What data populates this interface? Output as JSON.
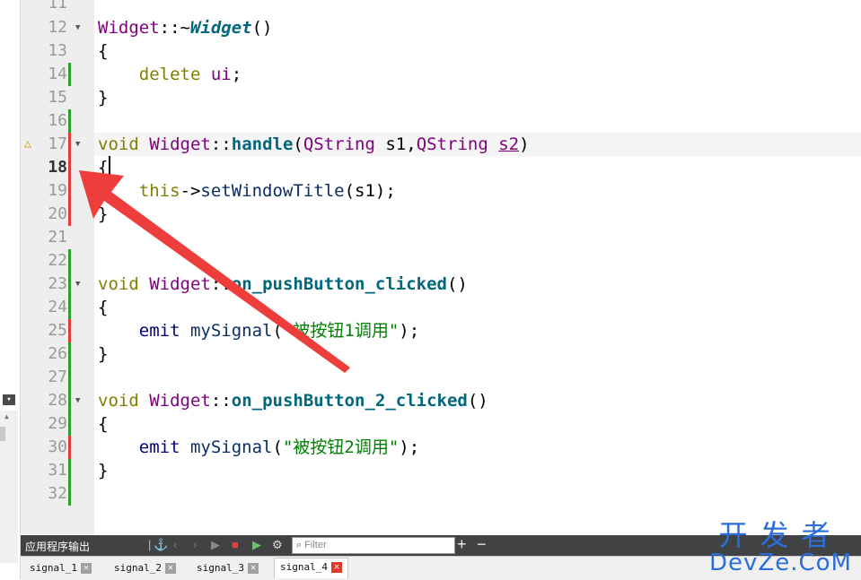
{
  "editor": {
    "first_line_partial": "11",
    "lines": [
      {
        "n": "12",
        "code": [
          {
            "t": "typ",
            "s": "Widget"
          },
          {
            "t": "",
            "s": "::~"
          },
          {
            "t": "fni",
            "s": "Widget"
          },
          {
            "t": "",
            "s": "()"
          }
        ],
        "fold": true
      },
      {
        "n": "13",
        "code": [
          {
            "t": "",
            "s": "{"
          }
        ]
      },
      {
        "n": "14",
        "code": [
          {
            "t": "",
            "s": "    "
          },
          {
            "t": "kw",
            "s": "delete"
          },
          {
            "t": "",
            "s": " "
          },
          {
            "t": "typ",
            "s": "ui"
          },
          {
            "t": "",
            "s": ";"
          }
        ]
      },
      {
        "n": "15",
        "code": [
          {
            "t": "",
            "s": "}"
          }
        ]
      },
      {
        "n": "16",
        "code": []
      },
      {
        "n": "17",
        "code": [
          {
            "t": "kw",
            "s": "void"
          },
          {
            "t": "",
            "s": " "
          },
          {
            "t": "typ",
            "s": "Widget"
          },
          {
            "t": "",
            "s": "::"
          },
          {
            "t": "fn",
            "s": "handle"
          },
          {
            "t": "",
            "s": "("
          },
          {
            "t": "typ",
            "s": "QString"
          },
          {
            "t": "",
            "s": " s1,"
          },
          {
            "t": "typ",
            "s": "QString"
          },
          {
            "t": "",
            "s": " "
          },
          {
            "t": "u",
            "s": "s2"
          },
          {
            "t": "",
            "s": ")"
          }
        ],
        "fold": true,
        "warn": true,
        "highlight": true
      },
      {
        "n": "18",
        "code": [
          {
            "t": "",
            "s": "{"
          }
        ],
        "current": true
      },
      {
        "n": "19",
        "code": [
          {
            "t": "",
            "s": "    "
          },
          {
            "t": "kw",
            "s": "this"
          },
          {
            "t": "",
            "s": "->"
          },
          {
            "t": "str2",
            "s": "setWindowTitle"
          },
          {
            "t": "",
            "s": "(s1);"
          }
        ]
      },
      {
        "n": "20",
        "code": [
          {
            "t": "",
            "s": "}"
          }
        ]
      },
      {
        "n": "21",
        "code": []
      },
      {
        "n": "22",
        "code": []
      },
      {
        "n": "23",
        "code": [
          {
            "t": "kw",
            "s": "void"
          },
          {
            "t": "",
            "s": " "
          },
          {
            "t": "typ",
            "s": "Widget"
          },
          {
            "t": "",
            "s": "::"
          },
          {
            "t": "fn",
            "s": "on_pushButton_clicked"
          },
          {
            "t": "",
            "s": "()"
          }
        ],
        "fold": true
      },
      {
        "n": "24",
        "code": [
          {
            "t": "",
            "s": "{"
          }
        ]
      },
      {
        "n": "25",
        "code": [
          {
            "t": "",
            "s": "    "
          },
          {
            "t": "mac",
            "s": "emit"
          },
          {
            "t": "",
            "s": " "
          },
          {
            "t": "str2",
            "s": "mySignal"
          },
          {
            "t": "",
            "s": "("
          },
          {
            "t": "str",
            "s": "\"被按钮1调用\""
          },
          {
            "t": "",
            "s": ");"
          }
        ]
      },
      {
        "n": "26",
        "code": [
          {
            "t": "",
            "s": "}"
          }
        ]
      },
      {
        "n": "27",
        "code": []
      },
      {
        "n": "28",
        "code": [
          {
            "t": "kw",
            "s": "void"
          },
          {
            "t": "",
            "s": " "
          },
          {
            "t": "typ",
            "s": "Widget"
          },
          {
            "t": "",
            "s": "::"
          },
          {
            "t": "fn",
            "s": "on_pushButton_2_clicked"
          },
          {
            "t": "",
            "s": "()"
          }
        ],
        "fold": true
      },
      {
        "n": "29",
        "code": [
          {
            "t": "",
            "s": "{"
          }
        ]
      },
      {
        "n": "30",
        "code": [
          {
            "t": "",
            "s": "    "
          },
          {
            "t": "mac",
            "s": "emit"
          },
          {
            "t": "",
            "s": " "
          },
          {
            "t": "str2",
            "s": "mySignal"
          },
          {
            "t": "",
            "s": "("
          },
          {
            "t": "str",
            "s": "\"被按钮2调用\""
          },
          {
            "t": "",
            "s": ");"
          }
        ]
      },
      {
        "n": "31",
        "code": [
          {
            "t": "",
            "s": "}"
          }
        ]
      },
      {
        "n": "32",
        "code": []
      }
    ],
    "change_marks": {
      "14": "#2e9e2e",
      "16": "#2e9e2e",
      "17": "#e33b3b",
      "18": "#e33b3b",
      "19": "#e33b3b",
      "20": "#e33b3b",
      "22": "#2e9e2e",
      "23": "#2e9e2e",
      "24": "#2e9e2e",
      "25": "#e33b3b",
      "26": "#2e9e2e",
      "27": "#2e9e2e",
      "28": "#2e9e2e",
      "29": "#2e9e2e",
      "30": "#e33b3b",
      "31": "#2e9e2e",
      "32": "#2e9e2e"
    }
  },
  "output_pane": {
    "title": "应用程序输出",
    "filter_placeholder": "Filter",
    "add_label": "+",
    "remove_label": "−"
  },
  "tabs": [
    {
      "label": "signal_1",
      "active": false
    },
    {
      "label": "signal_2",
      "active": false
    },
    {
      "label": "signal_3",
      "active": false
    },
    {
      "label": "signal_4",
      "active": true
    }
  ],
  "tab_close_glyph": "✕",
  "watermark": {
    "cn": "开发者",
    "en": "DevZe.CoM"
  },
  "colors": {
    "arrow": "#ee3e3b",
    "watermark": "#2a6fd8",
    "keyword": "#808000",
    "type": "#800080",
    "function": "#00677c",
    "string": "#008000"
  }
}
